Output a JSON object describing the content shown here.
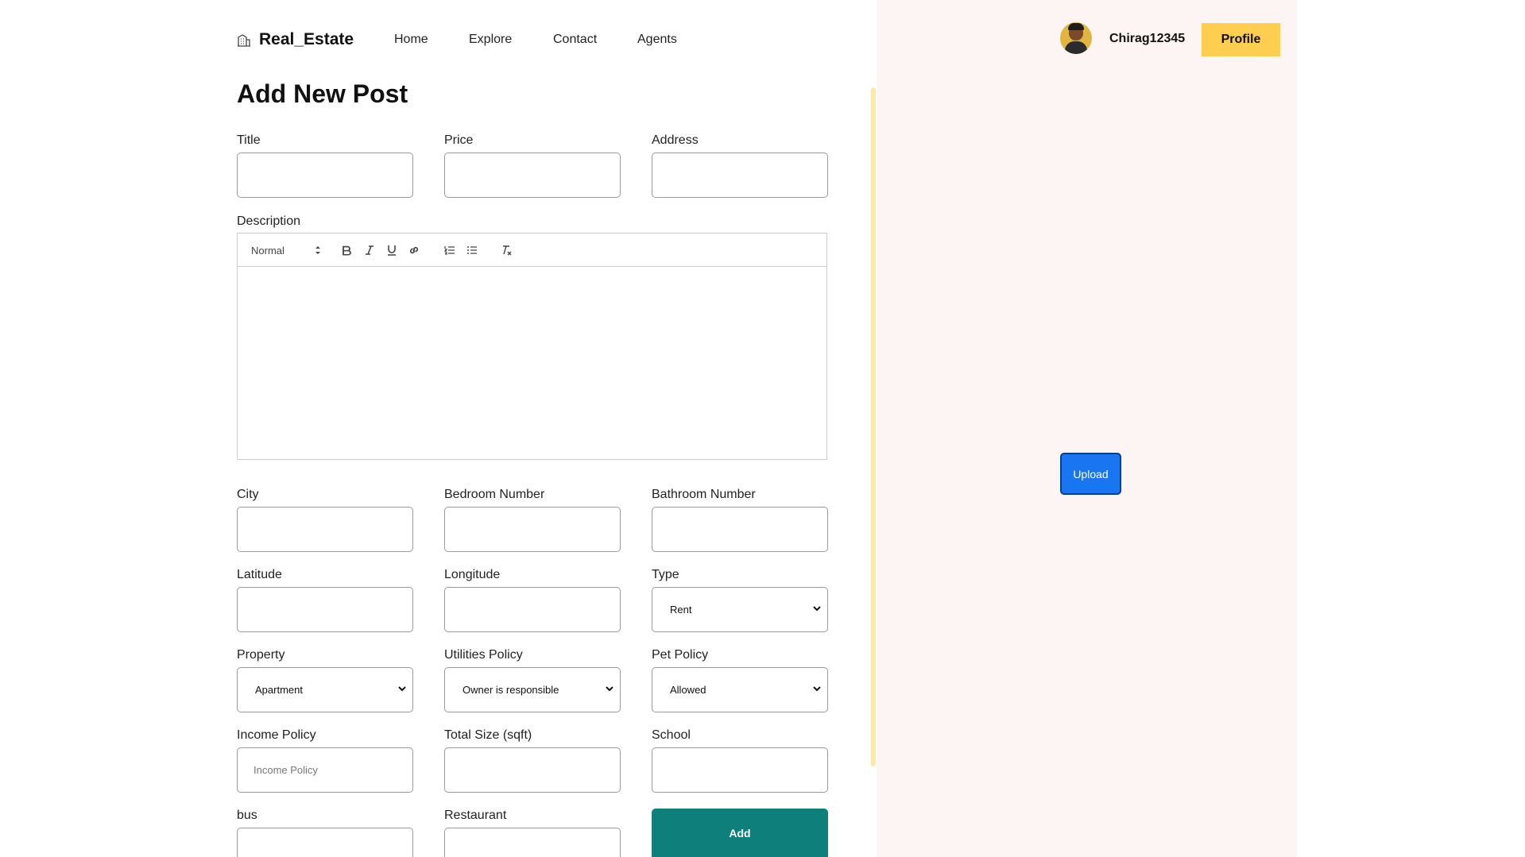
{
  "brand": {
    "name": "Real_Estate",
    "icon": "building-icon"
  },
  "nav": {
    "items": [
      "Home",
      "Explore",
      "Contact",
      "Agents"
    ]
  },
  "user": {
    "name": "Chirag12345",
    "profile_label": "Profile"
  },
  "page": {
    "title": "Add New Post"
  },
  "form": {
    "title_label": "Title",
    "price_label": "Price",
    "address_label": "Address",
    "description_label": "Description",
    "editor": {
      "format": "Normal"
    },
    "city_label": "City",
    "bedroom_label": "Bedroom Number",
    "bathroom_label": "Bathroom Number",
    "latitude_label": "Latitude",
    "longitude_label": "Longitude",
    "type_label": "Type",
    "type_value": "Rent",
    "property_label": "Property",
    "property_value": "Apartment",
    "utilities_label": "Utilities Policy",
    "utilities_value": "Owner is responsible",
    "pet_label": "Pet Policy",
    "pet_value": "Allowed",
    "income_label": "Income Policy",
    "income_placeholder": "Income Policy",
    "size_label": "Total Size (sqft)",
    "school_label": "School",
    "bus_label": "bus",
    "restaurant_label": "Restaurant",
    "add_label": "Add"
  },
  "upload": {
    "label": "Upload"
  },
  "colors": {
    "accent_yellow": "#fece51",
    "add_teal": "#0f7f7b",
    "upload_blue": "#1976f0",
    "side_panel": "#fcf5f3"
  }
}
